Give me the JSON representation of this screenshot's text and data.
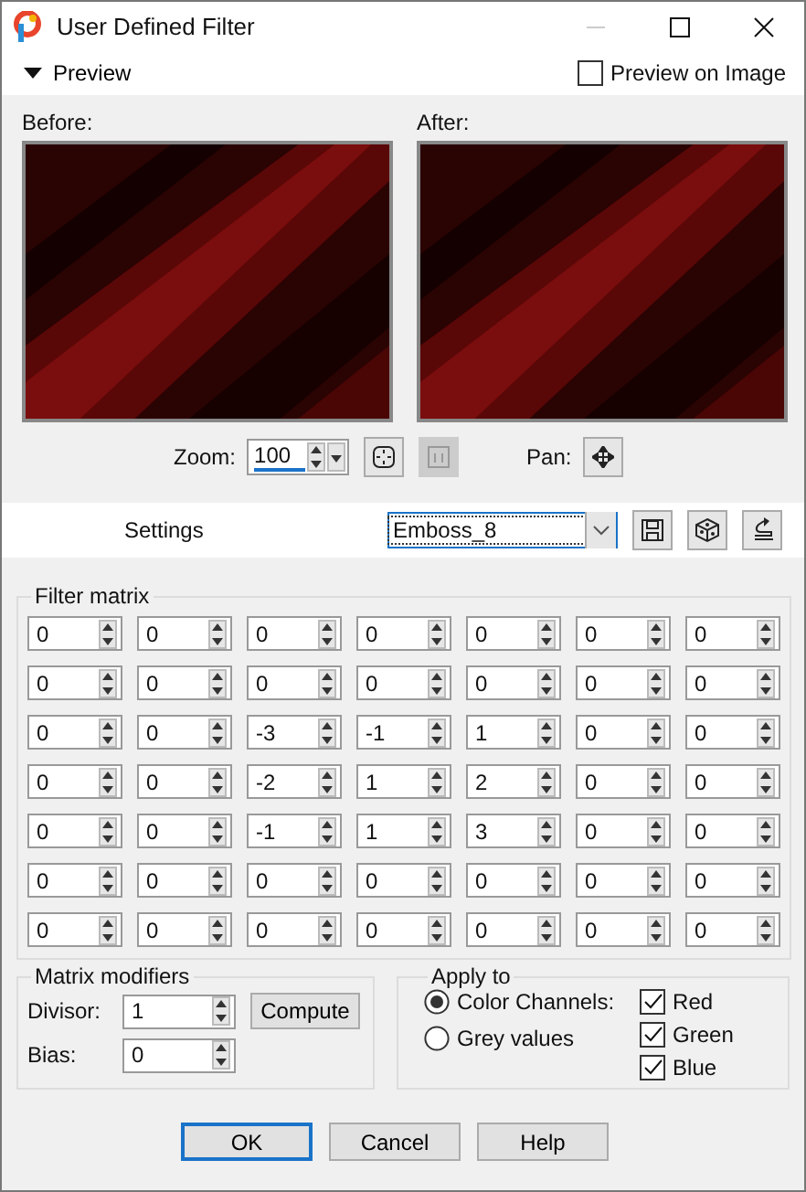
{
  "window": {
    "title": "User Defined Filter"
  },
  "preview": {
    "label": "Preview",
    "expanded": true,
    "preview_on_image": {
      "label": "Preview on Image",
      "checked": false
    },
    "before_label": "Before:",
    "after_label": "After:",
    "zoom": {
      "label": "Zoom:",
      "value": "100"
    },
    "pan_label": "Pan:"
  },
  "settings": {
    "label": "Settings",
    "preset": "Emboss_8"
  },
  "filter_matrix": {
    "title": "Filter matrix",
    "rows": [
      [
        "0",
        "0",
        "0",
        "0",
        "0",
        "0",
        "0"
      ],
      [
        "0",
        "0",
        "0",
        "0",
        "0",
        "0",
        "0"
      ],
      [
        "0",
        "0",
        "-3",
        "-1",
        "1",
        "0",
        "0"
      ],
      [
        "0",
        "0",
        "-2",
        "1",
        "2",
        "0",
        "0"
      ],
      [
        "0",
        "0",
        "-1",
        "1",
        "3",
        "0",
        "0"
      ],
      [
        "0",
        "0",
        "0",
        "0",
        "0",
        "0",
        "0"
      ],
      [
        "0",
        "0",
        "0",
        "0",
        "0",
        "0",
        "0"
      ]
    ]
  },
  "matrix_modifiers": {
    "title": "Matrix modifiers",
    "divisor": {
      "label": "Divisor:",
      "value": "1"
    },
    "bias": {
      "label": "Bias:",
      "value": "0"
    },
    "compute_button": "Compute"
  },
  "apply_to": {
    "title": "Apply to",
    "modes": [
      {
        "label": "Color Channels:",
        "selected": true
      },
      {
        "label": "Grey values",
        "selected": false
      }
    ],
    "channels": [
      {
        "label": "Red",
        "checked": true
      },
      {
        "label": "Green",
        "checked": true
      },
      {
        "label": "Blue",
        "checked": true
      }
    ]
  },
  "buttons": [
    {
      "label": "OK",
      "default": true
    },
    {
      "label": "Cancel",
      "default": false
    },
    {
      "label": "Help",
      "default": false
    }
  ]
}
